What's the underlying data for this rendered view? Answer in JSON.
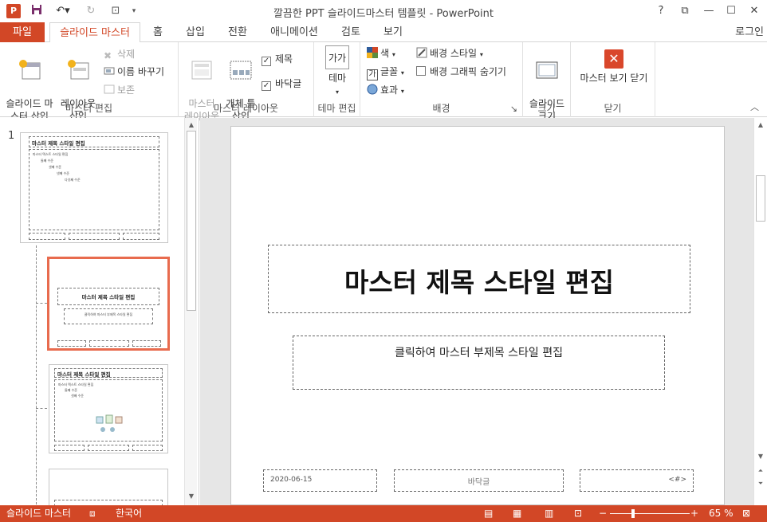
{
  "window": {
    "title": "깔끔한 PPT 슬라이드마스터 템플릿 - PowerPoint",
    "app_icon": "P",
    "controls": [
      "?",
      "⧉",
      "—",
      "☐",
      "✕"
    ]
  },
  "tabs": {
    "file": "파일",
    "items": [
      "슬라이드 마스터",
      "홈",
      "삽입",
      "전환",
      "애니메이션",
      "검토",
      "보기"
    ],
    "login": "로그인"
  },
  "ribbon": {
    "master_edit": {
      "label": "마스터 편집",
      "insert_master": "슬라이드 마\n스터 삽입",
      "insert_layout": "레이아웃\n삽입",
      "delete": "삭제",
      "rename": "이름 바꾸기",
      "preserve": "보존"
    },
    "master_layout": {
      "label": "마스터 레이아웃",
      "master_layout_btn": "마스터\n레이아웃",
      "insert_placeholder": "개체 틀\n삽입",
      "title_check": "제목",
      "footer_check": "바닥글"
    },
    "theme_edit": {
      "label": "테마 편집",
      "theme_btn": "테마",
      "theme_icon_text": "가가"
    },
    "background": {
      "label": "배경",
      "colors": "색",
      "fonts": "글꼴",
      "effects": "효과",
      "bg_styles": "배경 스타일",
      "hide_bg": "배경 그래픽 숨기기"
    },
    "size": {
      "label": "크기",
      "slide_size": "슬라이드\n크기"
    },
    "close": {
      "label": "닫기",
      "close_master": "마스터 보기 닫기"
    }
  },
  "thumbnails": {
    "slide_number": "1",
    "master_title": "마스터 제목 스타일 편집",
    "master_text": "마스터 텍스트 스타일 편집",
    "level2": "둘째 수준",
    "level3": "셋째 수준",
    "level4": "넷째 수준",
    "level5": "다섯째 수준",
    "layout1_title": "마스터 제목 스타일 편집",
    "layout1_sub": "클릭하여 마스터 부제목 스타일 편집",
    "layout2_title": "마스터 제목 스타일 편집"
  },
  "slide": {
    "title": "마스터 제목 스타일 편집",
    "subtitle": "클릭하여 마스터 부제목 스타일 편집",
    "date": "2020-06-15",
    "footer": "바닥글",
    "number": "<#>"
  },
  "status": {
    "view": "슬라이드 마스터",
    "language": "한국어",
    "zoom": "65 %",
    "zoom_percent": 65
  },
  "colors": {
    "accent": "#d24726",
    "selected_thumb": "#e86b4e"
  }
}
